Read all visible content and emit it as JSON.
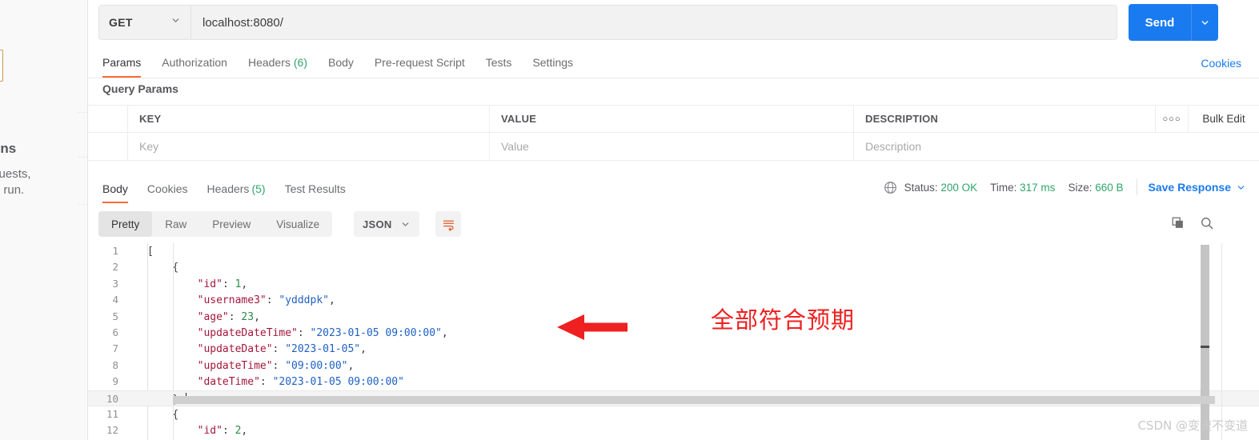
{
  "sidebar": {
    "heading_fragment": "lections",
    "line1_fragment": "ed requests,",
    "line2_fragment": "ss and run.",
    "link_fragment": "l"
  },
  "request": {
    "method": "GET",
    "url": "localhost:8080/",
    "send_label": "Send",
    "tabs": [
      {
        "label": "Params",
        "count": "",
        "active": true
      },
      {
        "label": "Authorization",
        "count": "",
        "active": false
      },
      {
        "label": "Headers",
        "count": "(6)",
        "active": false
      },
      {
        "label": "Body",
        "count": "",
        "active": false
      },
      {
        "label": "Pre-request Script",
        "count": "",
        "active": false
      },
      {
        "label": "Tests",
        "count": "",
        "active": false
      },
      {
        "label": "Settings",
        "count": "",
        "active": false
      }
    ],
    "cookies_link": "Cookies"
  },
  "query_params": {
    "title": "Query Params",
    "columns": [
      "KEY",
      "VALUE",
      "DESCRIPTION"
    ],
    "row_placeholders": [
      "Key",
      "Value",
      "Description"
    ],
    "more_actions": "○○○",
    "bulk_edit": "Bulk Edit"
  },
  "response": {
    "tabs": [
      {
        "label": "Body",
        "count": "",
        "active": true
      },
      {
        "label": "Cookies",
        "count": "",
        "active": false
      },
      {
        "label": "Headers",
        "count": "(5)",
        "active": false
      },
      {
        "label": "Test Results",
        "count": "",
        "active": false
      }
    ],
    "status_label": "Status:",
    "status_value": "200 OK",
    "time_label": "Time:",
    "time_value": "317 ms",
    "size_label": "Size:",
    "size_value": "660 B",
    "save_response": "Save Response",
    "view_modes": [
      {
        "label": "Pretty",
        "active": true
      },
      {
        "label": "Raw",
        "active": false
      },
      {
        "label": "Preview",
        "active": false
      },
      {
        "label": "Visualize",
        "active": false
      }
    ],
    "format": "JSON"
  },
  "code": {
    "lines": [
      {
        "no": "1",
        "indent": 0,
        "tokens": [
          {
            "t": "p",
            "v": "["
          }
        ],
        "highlight": false,
        "caret": false
      },
      {
        "no": "2",
        "indent": 1,
        "tokens": [
          {
            "t": "p",
            "v": "{"
          }
        ],
        "highlight": false,
        "caret": false
      },
      {
        "no": "3",
        "indent": 2,
        "tokens": [
          {
            "t": "k",
            "v": "\"id\""
          },
          {
            "t": "p",
            "v": ": "
          },
          {
            "t": "n",
            "v": "1"
          },
          {
            "t": "p",
            "v": ","
          }
        ],
        "highlight": false,
        "caret": false
      },
      {
        "no": "4",
        "indent": 2,
        "tokens": [
          {
            "t": "k",
            "v": "\"username3\""
          },
          {
            "t": "p",
            "v": ": "
          },
          {
            "t": "s",
            "v": "\"ydddpk\""
          },
          {
            "t": "p",
            "v": ","
          }
        ],
        "highlight": false,
        "caret": false
      },
      {
        "no": "5",
        "indent": 2,
        "tokens": [
          {
            "t": "k",
            "v": "\"age\""
          },
          {
            "t": "p",
            "v": ": "
          },
          {
            "t": "n",
            "v": "23"
          },
          {
            "t": "p",
            "v": ","
          }
        ],
        "highlight": false,
        "caret": false
      },
      {
        "no": "6",
        "indent": 2,
        "tokens": [
          {
            "t": "k",
            "v": "\"updateDateTime\""
          },
          {
            "t": "p",
            "v": ": "
          },
          {
            "t": "s",
            "v": "\"2023-01-05 09:00:00\""
          },
          {
            "t": "p",
            "v": ","
          }
        ],
        "highlight": false,
        "caret": false
      },
      {
        "no": "7",
        "indent": 2,
        "tokens": [
          {
            "t": "k",
            "v": "\"updateDate\""
          },
          {
            "t": "p",
            "v": ": "
          },
          {
            "t": "s",
            "v": "\"2023-01-05\""
          },
          {
            "t": "p",
            "v": ","
          }
        ],
        "highlight": false,
        "caret": false
      },
      {
        "no": "8",
        "indent": 2,
        "tokens": [
          {
            "t": "k",
            "v": "\"updateTime\""
          },
          {
            "t": "p",
            "v": ": "
          },
          {
            "t": "s",
            "v": "\"09:00:00\""
          },
          {
            "t": "p",
            "v": ","
          }
        ],
        "highlight": false,
        "caret": false
      },
      {
        "no": "9",
        "indent": 2,
        "tokens": [
          {
            "t": "k",
            "v": "\"dateTime\""
          },
          {
            "t": "p",
            "v": ": "
          },
          {
            "t": "s",
            "v": "\"2023-01-05 09:00:00\""
          }
        ],
        "highlight": false,
        "caret": false
      },
      {
        "no": "10",
        "indent": 1,
        "tokens": [
          {
            "t": "p",
            "v": "},"
          }
        ],
        "highlight": true,
        "caret": true
      },
      {
        "no": "11",
        "indent": 1,
        "tokens": [
          {
            "t": "p",
            "v": "{"
          }
        ],
        "highlight": false,
        "caret": false
      },
      {
        "no": "12",
        "indent": 2,
        "tokens": [
          {
            "t": "k",
            "v": "\"id\""
          },
          {
            "t": "p",
            "v": ": "
          },
          {
            "t": "n",
            "v": "2"
          },
          {
            "t": "p",
            "v": ","
          }
        ],
        "highlight": false,
        "caret": false
      }
    ]
  },
  "annotation": {
    "text": "全部符合预期",
    "color": "#ee2020"
  },
  "watermark": "CSDN @变速不变道",
  "colors": {
    "accent": "#ff6c37",
    "primary": "#1a7bf0",
    "success": "#30a46c",
    "annotation": "#ee2020"
  }
}
